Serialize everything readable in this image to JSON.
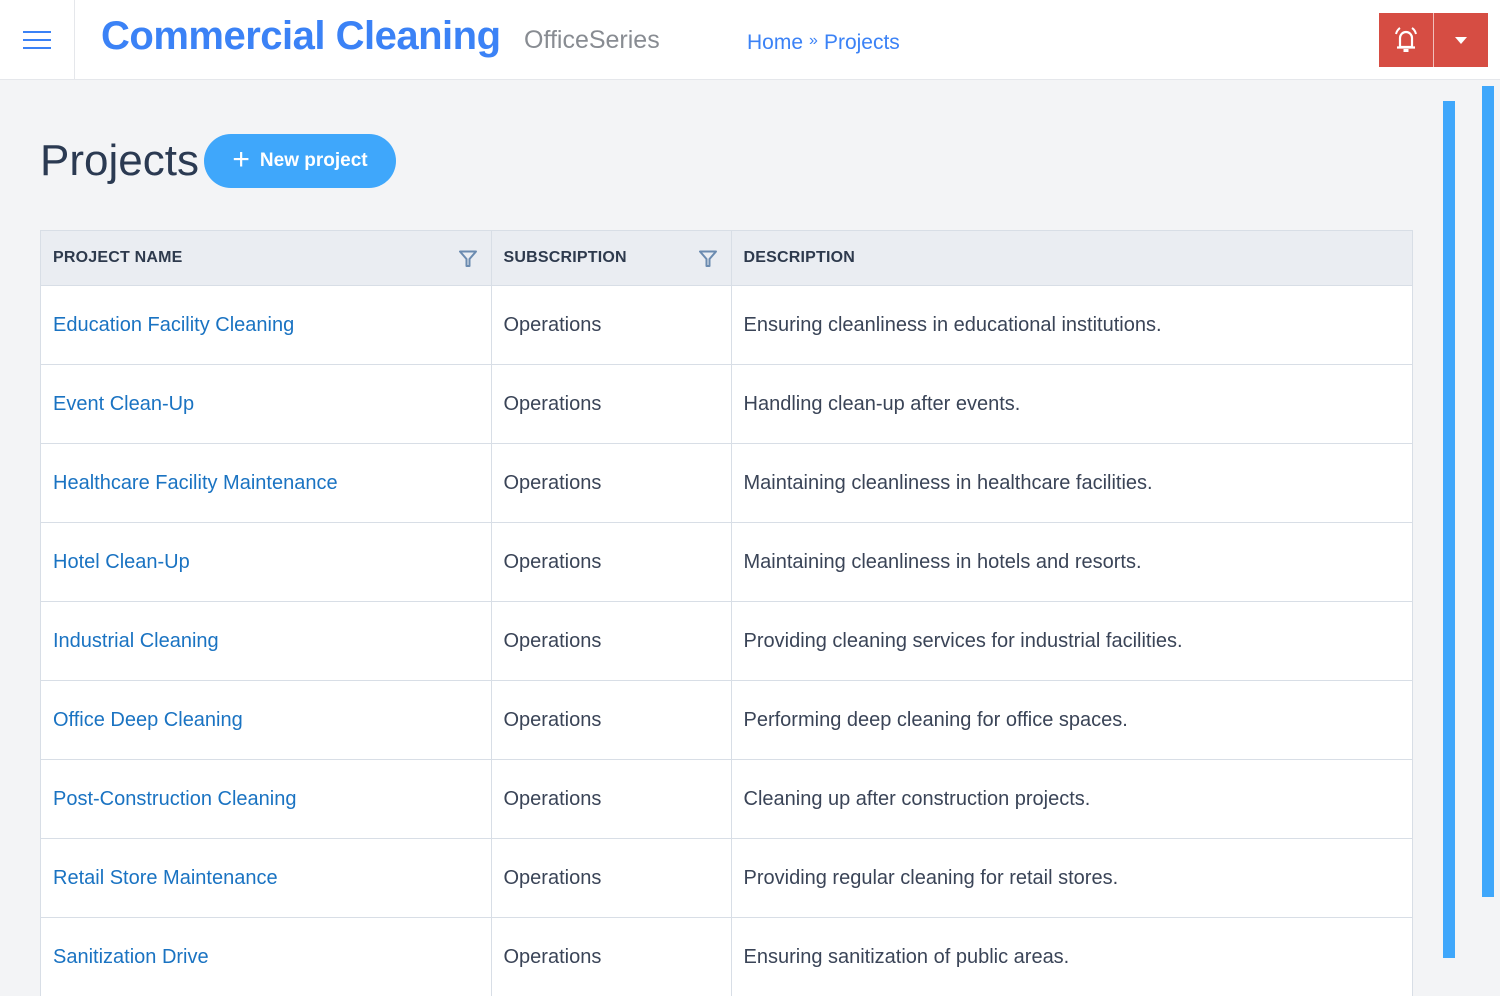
{
  "header": {
    "app_title": "Commercial Cleaning",
    "app_subtitle": "OfficeSeries",
    "breadcrumb": [
      {
        "label": "Home"
      },
      {
        "label": "Projects"
      }
    ],
    "breadcrumb_separator": "»",
    "colors": {
      "brand": "#3b82f6",
      "alert": "#d64d43"
    }
  },
  "page": {
    "title": "Projects",
    "new_button_label": "New project"
  },
  "table": {
    "columns": [
      "PROJECT NAME",
      "SUBSCRIPTION",
      "DESCRIPTION"
    ],
    "rows": [
      {
        "name": "Education Facility Cleaning",
        "subscription": "Operations",
        "description": "Ensuring cleanliness in educational institutions."
      },
      {
        "name": "Event Clean-Up",
        "subscription": "Operations",
        "description": "Handling clean-up after events."
      },
      {
        "name": "Healthcare Facility Maintenance",
        "subscription": "Operations",
        "description": "Maintaining cleanliness in healthcare facilities."
      },
      {
        "name": "Hotel Clean-Up",
        "subscription": "Operations",
        "description": "Maintaining cleanliness in hotels and resorts."
      },
      {
        "name": "Industrial Cleaning",
        "subscription": "Operations",
        "description": "Providing cleaning services for industrial facilities."
      },
      {
        "name": "Office Deep Cleaning",
        "subscription": "Operations",
        "description": "Performing deep cleaning for office spaces."
      },
      {
        "name": "Post-Construction Cleaning",
        "subscription": "Operations",
        "description": "Cleaning up after construction projects."
      },
      {
        "name": "Retail Store Maintenance",
        "subscription": "Operations",
        "description": "Providing regular cleaning for retail stores."
      },
      {
        "name": "Sanitization Drive",
        "subscription": "Operations",
        "description": "Ensuring sanitization of public areas."
      }
    ]
  }
}
